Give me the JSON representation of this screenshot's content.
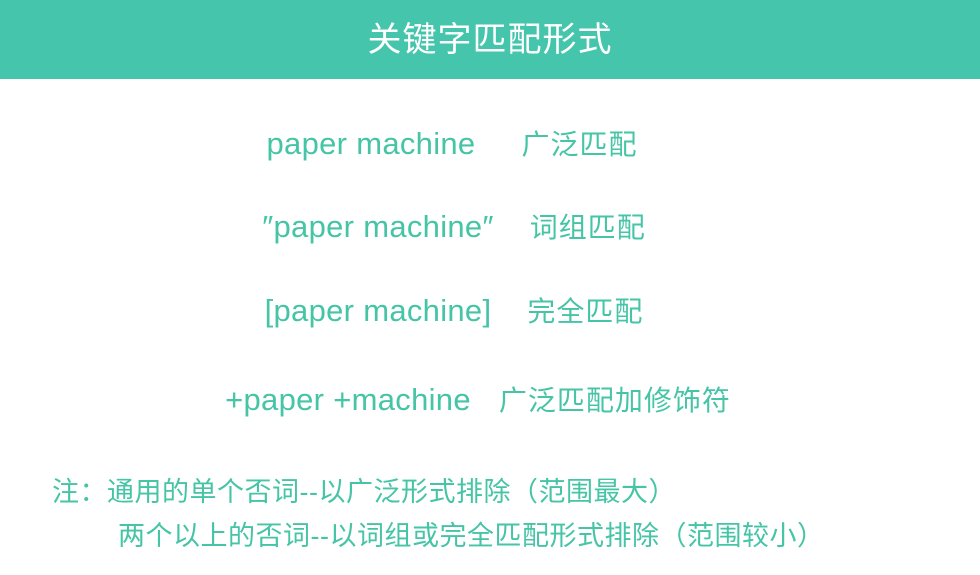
{
  "header": {
    "title": "关键字匹配形式",
    "background_color": "#44c5ac",
    "text_color": "#ffffff"
  },
  "theme": {
    "accent_color": "#44c5ac",
    "body_text_color": "#45c4a6",
    "page_background": "#ffffff"
  },
  "match_types": [
    {
      "syntax": "paper machine",
      "meaning": "广泛匹配"
    },
    {
      "syntax": "″paper machine″",
      "meaning": "词组匹配"
    },
    {
      "syntax": "[paper machine]",
      "meaning": "完全匹配"
    },
    {
      "syntax": "+paper +machine",
      "meaning": "广泛匹配加修饰符"
    }
  ],
  "note": {
    "line1": "注：通用的单个否词--以广泛形式排除（范围最大）",
    "line2": "两个以上的否词--以词组或完全匹配形式排除（范围较小）"
  }
}
